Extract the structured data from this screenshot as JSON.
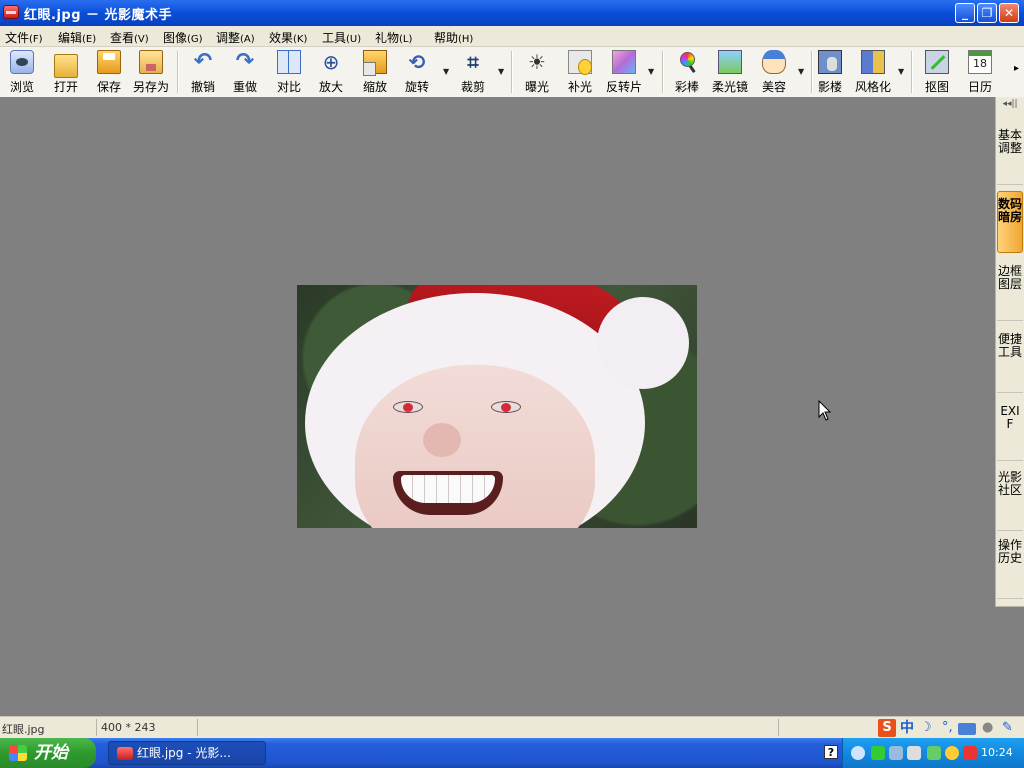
{
  "window": {
    "title": "红眼.jpg － 光影魔术手",
    "minimize": "_",
    "maximize": "❐",
    "close": "✕"
  },
  "menu": [
    {
      "label": "文件",
      "key": "(F)"
    },
    {
      "label": "编辑",
      "key": "(E)"
    },
    {
      "label": "查看",
      "key": "(V)"
    },
    {
      "label": "图像",
      "key": "(G)"
    },
    {
      "label": "调整",
      "key": "(A)"
    },
    {
      "label": "效果",
      "key": "(K)"
    },
    {
      "label": "工具",
      "key": "(U)"
    },
    {
      "label": "礼物",
      "key": "(L)"
    },
    {
      "label": "帮助",
      "key": "(H)"
    }
  ],
  "toolbar": {
    "browse": "浏览",
    "open": "打开",
    "save": "保存",
    "save_as": "另存为",
    "undo": "撤销",
    "redo": "重做",
    "compare": "对比",
    "zoom_in": "放大",
    "resize": "缩放",
    "rotate": "旋转",
    "crop": "裁剪",
    "exposure": "曝光",
    "fill_light": "补光",
    "invert": "反转片",
    "color_wand": "彩棒",
    "soft_lens": "柔光镜",
    "beauty": "美容",
    "studio": "影楼",
    "stylize": "风格化",
    "cutout": "抠图",
    "calendar": "日历",
    "calendar_day": "18"
  },
  "side_tabs": [
    {
      "label": "基本调整",
      "active": false
    },
    {
      "label": "数码暗房",
      "active": true
    },
    {
      "label": "边框图层",
      "active": false
    },
    {
      "label": "便捷工具",
      "active": false
    },
    {
      "label": "EXIF",
      "active": false
    },
    {
      "label": "光影社区",
      "active": false
    },
    {
      "label": "操作历史",
      "active": false
    }
  ],
  "status": {
    "filename": "红眼.jpg",
    "dimensions": "400 * 243",
    "ime_zh": "中"
  },
  "taskbar": {
    "start": "开始",
    "task_label": "红眼.jpg - 光影...",
    "clock": "10:24"
  },
  "colors": {
    "accent_tab": "#f0a630",
    "title_bar": "#0a4fd8",
    "workspace": "#808080"
  }
}
